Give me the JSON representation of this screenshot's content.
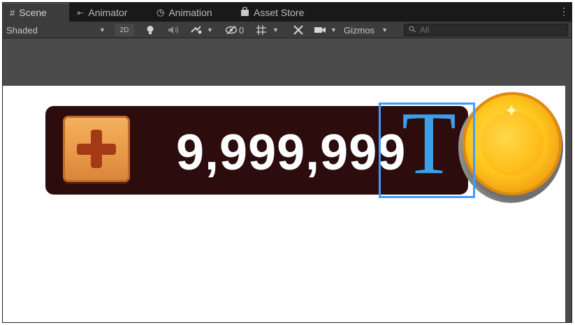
{
  "tabs": [
    {
      "label": "Scene",
      "icon": "grid-icon",
      "glyph": "#",
      "active": true
    },
    {
      "label": "Animator",
      "icon": "animator-icon",
      "glyph": "⤜",
      "active": false
    },
    {
      "label": "Animation",
      "icon": "animation-clock-icon",
      "glyph": "◷",
      "active": false
    },
    {
      "label": "Asset Store",
      "icon": "shopping-bag-icon",
      "glyph": "🛍",
      "active": false
    }
  ],
  "toolbar": {
    "draw_mode": "Shaded",
    "toggle_2d": "2D",
    "hidden_count": "0",
    "gizmos_label": "Gizmos",
    "search_placeholder": "All"
  },
  "game_ui": {
    "amount_text": "9,999,999",
    "text_gizmo_glyph": "T"
  },
  "colors": {
    "editor_dark": "#191919",
    "toolbar": "#3c3c3c",
    "viewport_gray": "#4b4b4b",
    "bar_brown": "#2c0c0c",
    "selection_blue": "#3e9cff",
    "coin_gold": "#ffc81e"
  }
}
